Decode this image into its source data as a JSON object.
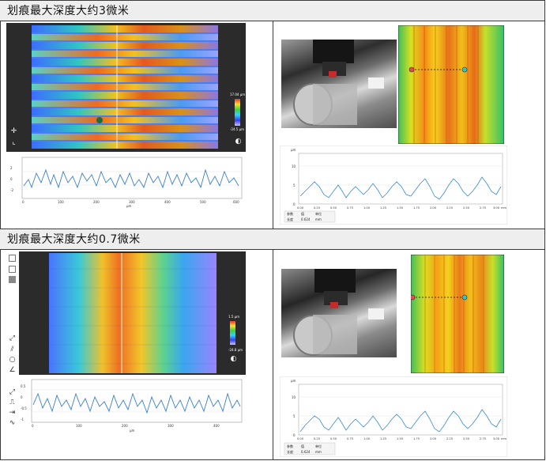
{
  "sections": [
    {
      "title": "划痕最大深度大约3微米",
      "left_panel": {
        "legend_top": "17.04 μm",
        "legend_bottom": "-24.5 μm",
        "profile_x_ticks": [
          "0",
          "100",
          "200",
          "300",
          "400",
          "500",
          "600"
        ],
        "profile_y_ticks": [
          "2",
          "0",
          "-2"
        ],
        "x_unit": "μm"
      },
      "right_panel": {
        "y_unit": "μm",
        "y_ticks": [
          "10",
          "5",
          "0"
        ],
        "x_ticks": [
          "0.00",
          "0.25",
          "0.50",
          "0.75",
          "1.00",
          "1.25",
          "1.50",
          "1.75",
          "2.00",
          "2.25",
          "2.50",
          "2.75",
          "3.00"
        ],
        "x_unit": "mm",
        "table_headers": [
          "参数",
          "值",
          "单位"
        ],
        "table_row": [
          "长度",
          "0.624",
          "mm"
        ]
      }
    },
    {
      "title": "划痕最大深度大约0.7微米",
      "left_panel": {
        "legend_top": "1.5 μm",
        "legend_bottom": "-24.8 μm",
        "profile_x_ticks": [
          "0",
          "100",
          "200",
          "300",
          "400"
        ],
        "profile_y_ticks": [
          "0.5",
          "0",
          "-0.5",
          "-1"
        ],
        "x_unit": "μm"
      },
      "right_panel": {
        "y_unit": "μm",
        "y_ticks": [
          "10",
          "5",
          "0"
        ],
        "x_ticks": [
          "0.00",
          "0.25",
          "0.50",
          "0.75",
          "1.00",
          "1.25",
          "1.50",
          "1.75",
          "2.00",
          "2.25",
          "2.50",
          "2.75",
          "3.00"
        ],
        "x_unit": "mm",
        "table_headers": [
          "参数",
          "值",
          "单位"
        ],
        "table_row": [
          "长度",
          "0.624",
          "mm"
        ]
      }
    }
  ]
}
